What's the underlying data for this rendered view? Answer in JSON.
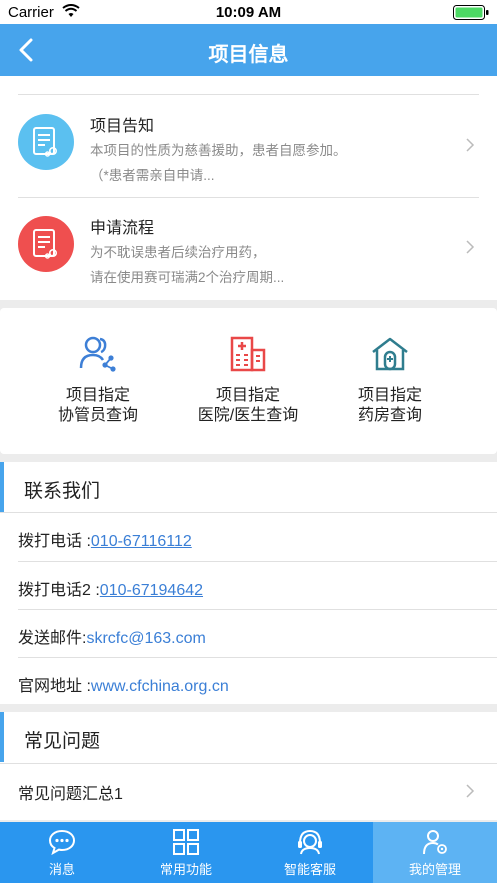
{
  "status_bar": {
    "carrier": "Carrier",
    "time": "10:09 AM"
  },
  "nav": {
    "title": "项目信息"
  },
  "notices": [
    {
      "title": "项目告知",
      "line1": "本项目的性质为慈善援助，患者自愿参加。",
      "line2": "（*患者需亲自申请...",
      "color": "#5bc0f0",
      "icon": "document-icon"
    },
    {
      "title": "申请流程",
      "line1": "为不耽误患者后续治疗用药，",
      "line2": "请在使用赛可瑞满2个治疗周期...",
      "color": "#ef4f4f",
      "icon": "document-icon"
    }
  ],
  "shortcuts": [
    {
      "line1": "项目指定",
      "line2": "协管员查询",
      "icon": "users-icon",
      "color": "#3d7fd6"
    },
    {
      "line1": "项目指定",
      "line2": "医院/医生查询",
      "icon": "hospital-icon",
      "color": "#e94848"
    },
    {
      "line1": "项目指定",
      "line2": "药房查询",
      "icon": "pharmacy-icon",
      "color": "#2f7d8e"
    }
  ],
  "contact": {
    "heading": "联系我们",
    "rows": [
      {
        "label": "拨打电话 :",
        "value": "010-67116112",
        "style": "link"
      },
      {
        "label": "拨打电话2 :",
        "value": "010-67194642",
        "style": "link"
      },
      {
        "label": "发送邮件:",
        "value": "skrcfc@163.com",
        "style": "blue"
      },
      {
        "label": "官网地址 :",
        "value": "www.cfchina.org.cn",
        "style": "blue"
      }
    ]
  },
  "faq": {
    "heading": "常见问题",
    "items": [
      {
        "label": "常见问题汇总1"
      }
    ]
  },
  "tabs": [
    {
      "label": "消息",
      "icon": "message-icon",
      "active": false
    },
    {
      "label": "常用功能",
      "icon": "grid-icon",
      "active": false
    },
    {
      "label": "智能客服",
      "icon": "headset-icon",
      "active": false
    },
    {
      "label": "我的管理",
      "icon": "user-gear-icon",
      "active": true
    }
  ],
  "colors": {
    "primary": "#47a4ec",
    "tab_bar": "#2a96ef",
    "tab_active": "#5db3f3",
    "link": "#3b7fd6"
  }
}
